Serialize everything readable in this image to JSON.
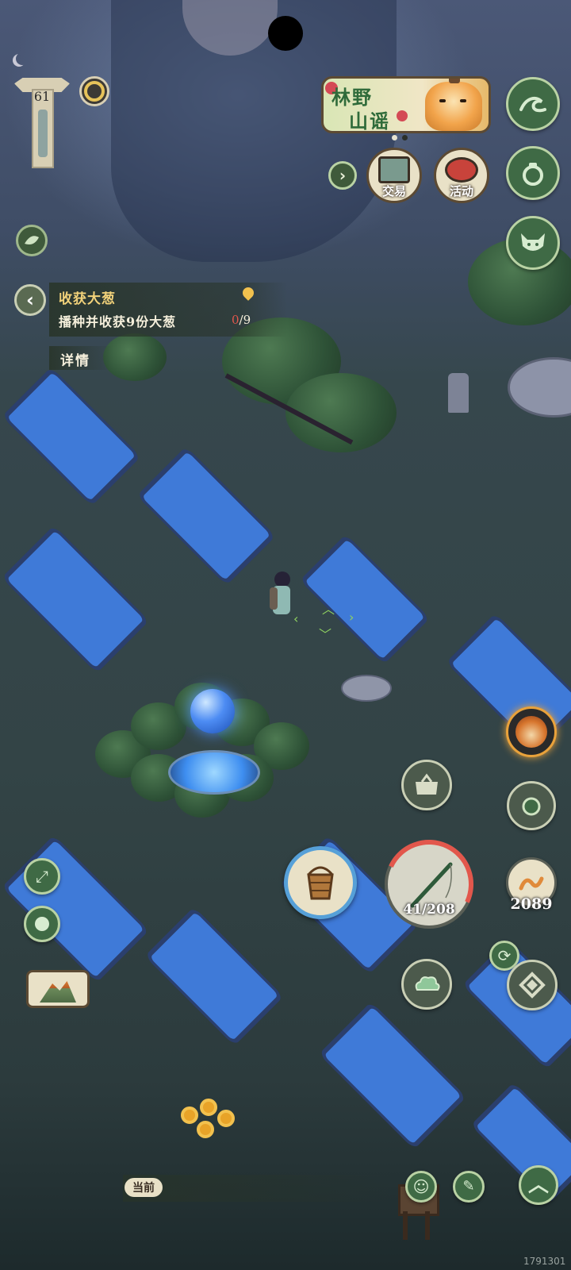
{
  "hud": {
    "level": "61",
    "event_banner": {
      "line1": "林野",
      "line2": "山谣"
    },
    "shop_buttons": [
      {
        "label": "交易"
      },
      {
        "label": "活动"
      }
    ]
  },
  "quest": {
    "title": "收获大葱",
    "description": "播种并收获9份大葱",
    "progress_current": "0",
    "progress_total": "/9",
    "details_label": "详情"
  },
  "tools": {
    "rod_durability": "41/208",
    "bait_count": "2089"
  },
  "chat": {
    "tag": "当前"
  },
  "footer": {
    "id": "1791301"
  },
  "colors": {
    "pond": "#3f7ad8",
    "grass": "#334446",
    "accent_gold": "#f2c14e",
    "progress_red": "#e2574c"
  }
}
